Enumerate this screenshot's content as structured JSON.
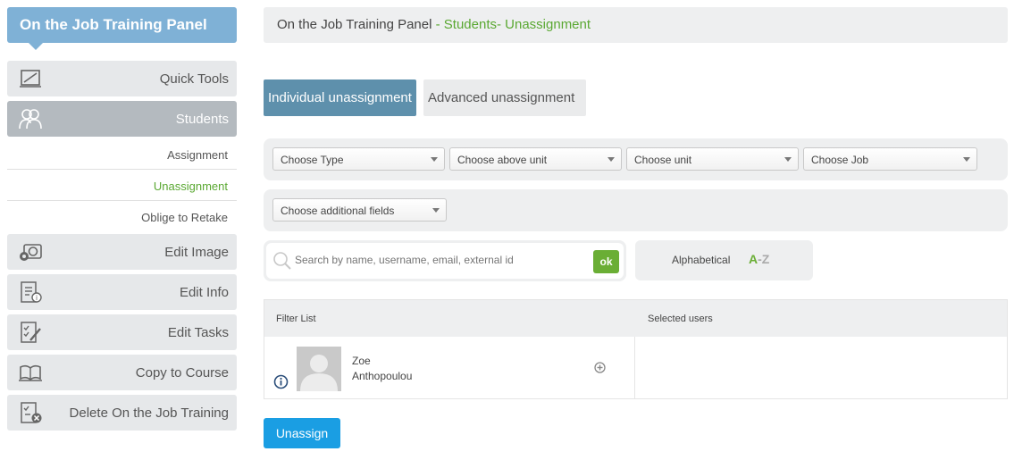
{
  "sidebar": {
    "title": "On the Job Training Panel",
    "items": [
      {
        "label": "Quick Tools",
        "icon": "quick-tools-icon"
      },
      {
        "label": "Students",
        "icon": "students-icon"
      }
    ],
    "sub_items": [
      "Assignment",
      "Unassignment",
      "Oblige to Retake"
    ],
    "items_after": [
      {
        "label": "Edit Image",
        "icon": "edit-image-icon"
      },
      {
        "label": "Edit Info",
        "icon": "edit-info-icon"
      },
      {
        "label": "Edit Tasks",
        "icon": "edit-tasks-icon"
      },
      {
        "label": "Copy to Course",
        "icon": "copy-to-course-icon"
      },
      {
        "label": "Delete On the Job Training",
        "icon": "delete-training-icon"
      }
    ]
  },
  "breadcrumb": {
    "root": "On the Job Training Panel",
    "path": " - Students- Unassignment"
  },
  "tabs": [
    "Individual unassignment",
    "Advanced unassignment"
  ],
  "filters": {
    "type": "Choose Type",
    "above_unit": "Choose above unit",
    "unit": "Choose unit",
    "job": "Choose Job",
    "additional": "Choose additional fields"
  },
  "search": {
    "placeholder": "Search by name, username, email, external id",
    "ok_label": "ok"
  },
  "sort": {
    "label": "Alphabetical",
    "a": "A",
    "dash": "-",
    "z": "Z"
  },
  "table": {
    "col_filter": "Filter List",
    "col_selected": "Selected users",
    "user": {
      "first_name": "Zoe",
      "last_name": "Anthopoulou"
    }
  },
  "actions": {
    "unassign_label": "Unassign"
  },
  "colors": {
    "panel_title_bg": "#7fb1d6",
    "active_tab_bg": "#5e90ac",
    "accent_green": "#5aa832",
    "ok_button": "#6aae35",
    "unassign_button": "#1a9ee3"
  }
}
